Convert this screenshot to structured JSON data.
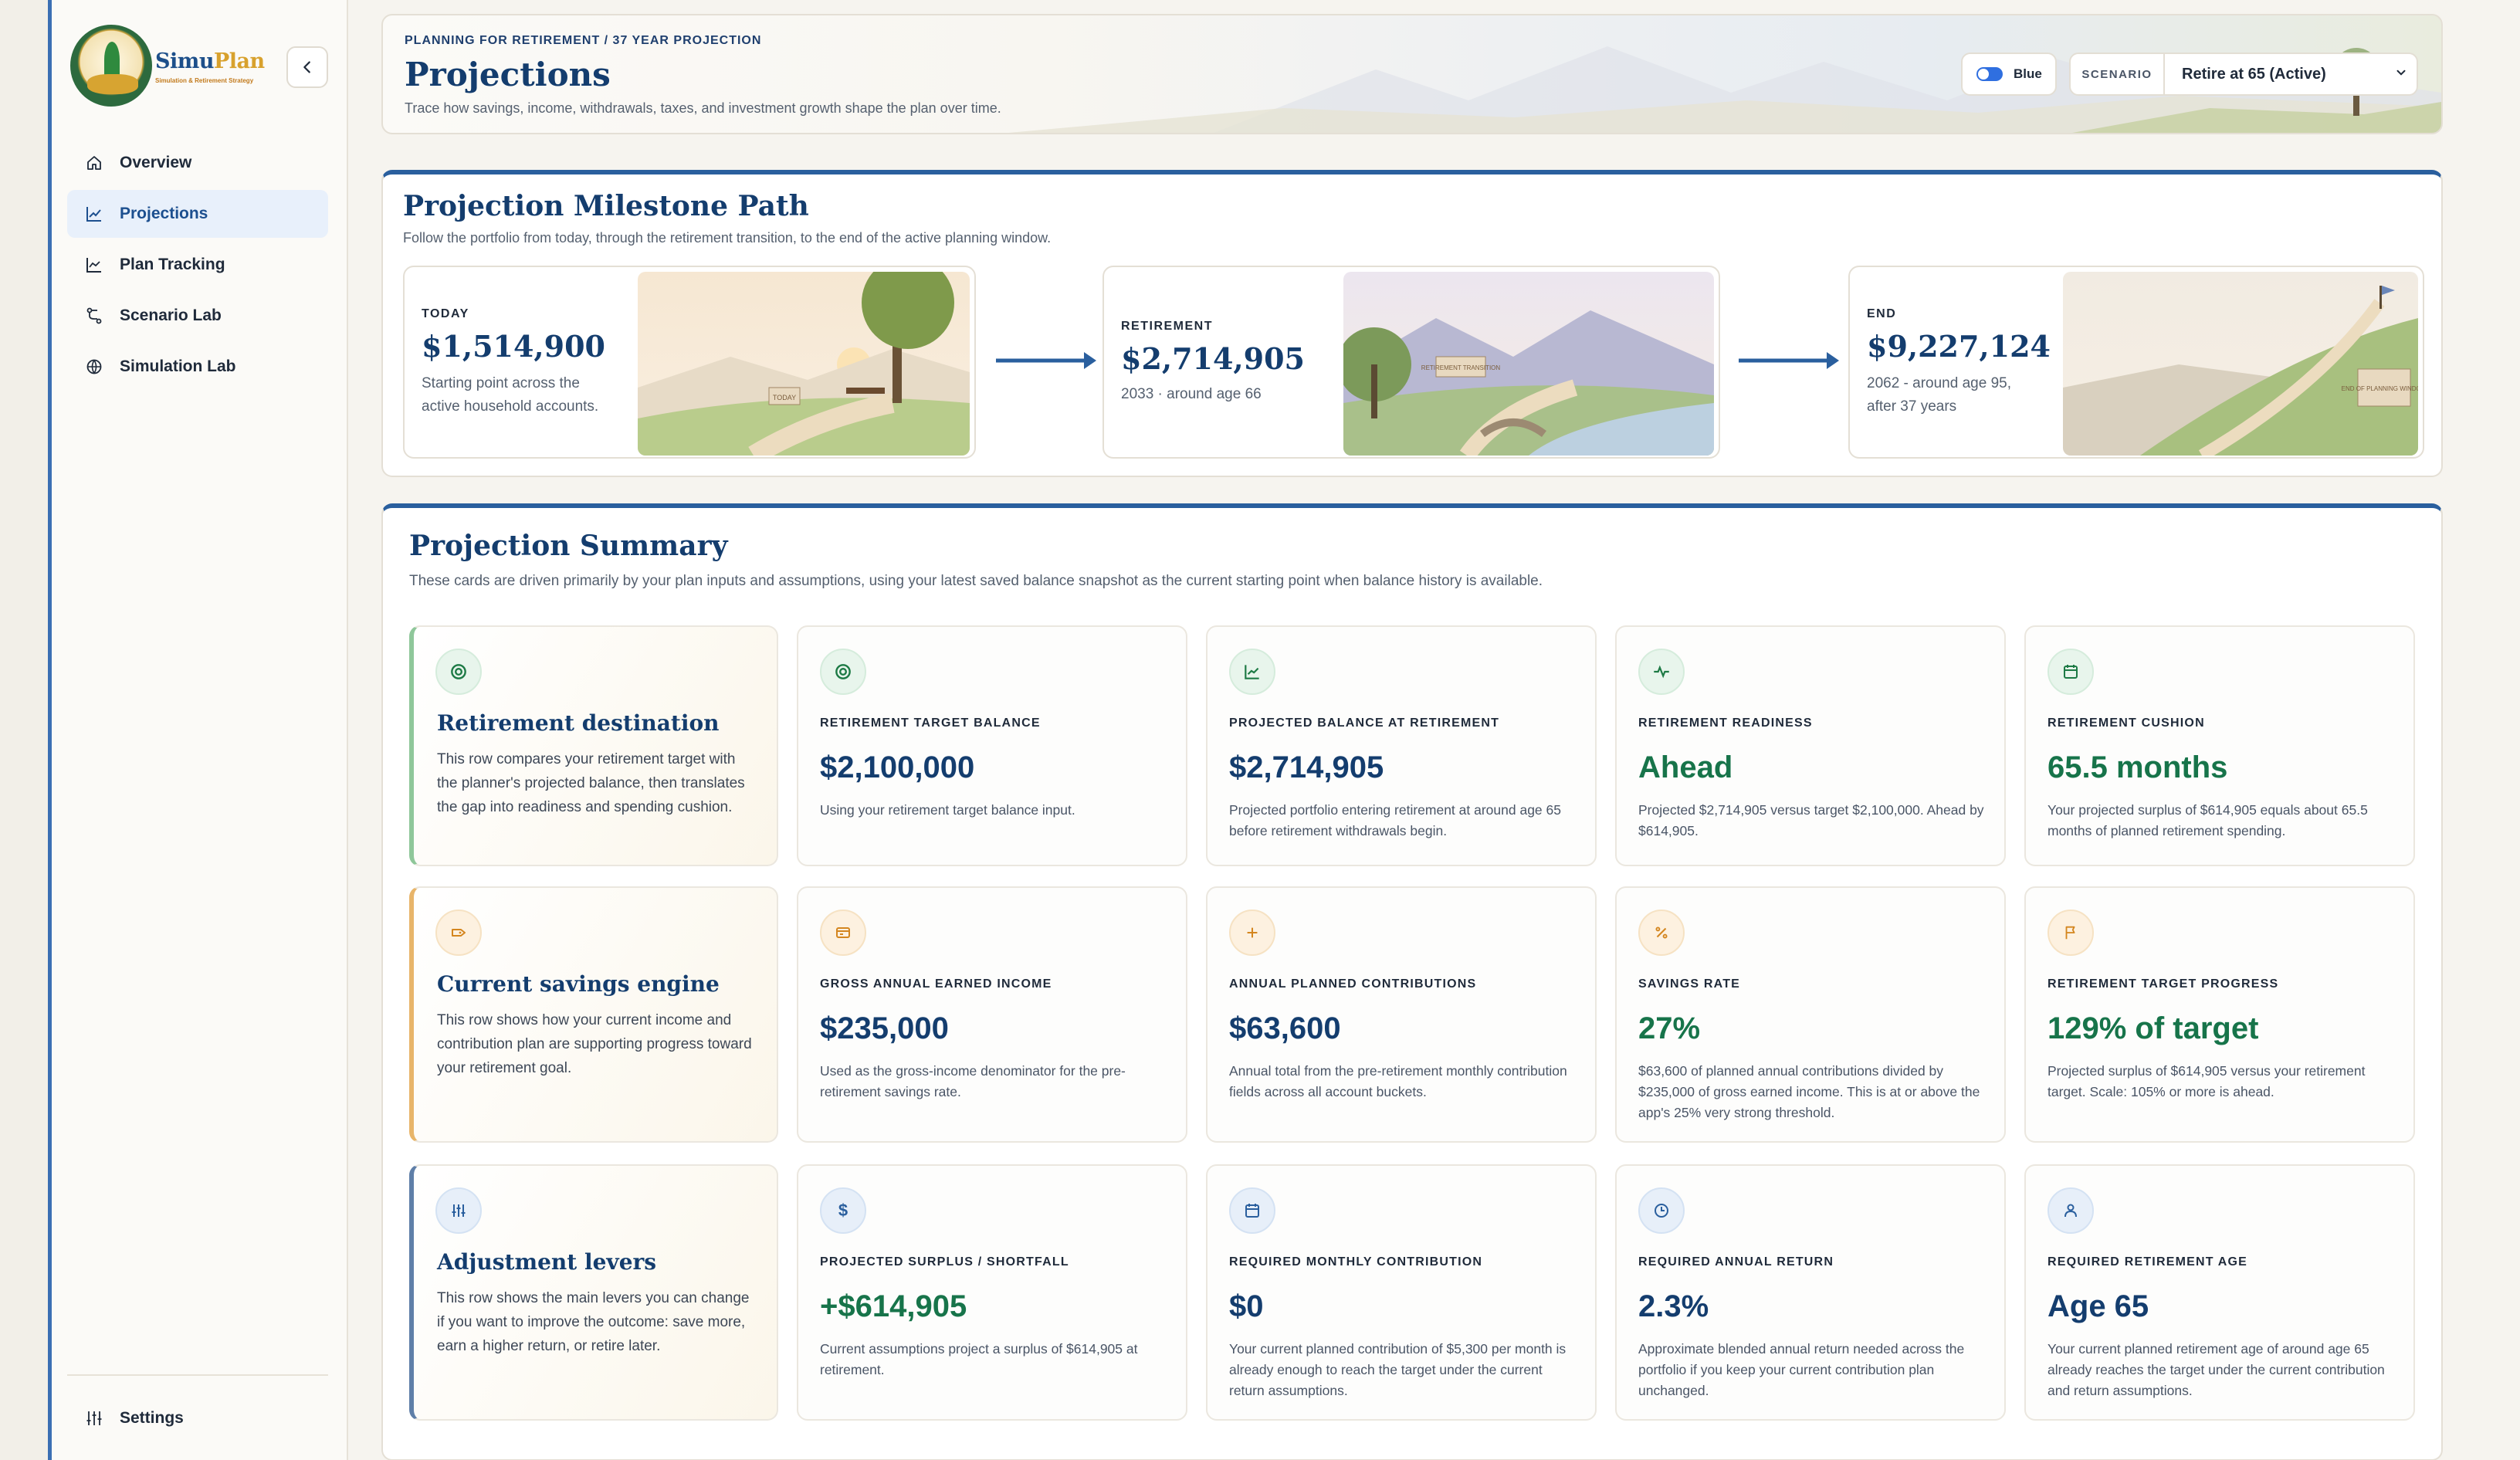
{
  "brand": {
    "name_a": "Simu",
    "name_b": "Plan",
    "tagline": "Simulation & Retirement Strategy"
  },
  "sidebar": {
    "items": [
      {
        "label": "Overview",
        "icon": "home-icon",
        "active": false
      },
      {
        "label": "Projections",
        "icon": "trend-chart-icon",
        "active": true
      },
      {
        "label": "Plan Tracking",
        "icon": "line-chart-icon",
        "active": false
      },
      {
        "label": "Scenario Lab",
        "icon": "branch-icon",
        "active": false
      },
      {
        "label": "Simulation Lab",
        "icon": "globe-icon",
        "active": false
      }
    ],
    "settings_label": "Settings"
  },
  "header": {
    "eyebrow": "PLANNING FOR RETIREMENT / 37 YEAR PROJECTION",
    "title": "Projections",
    "subtitle": "Trace how savings, income, withdrawals, taxes, and investment growth shape the plan over time.",
    "theme_label": "Blue",
    "scenario_label": "SCENARIO",
    "scenario_value": "Retire at 65 (Active)"
  },
  "milestones": {
    "title": "Projection Milestone Path",
    "subtitle": "Follow the portfolio from today, through the retirement transition, to the end of the active planning window.",
    "today": {
      "label": "TODAY",
      "value": "$1,514,900",
      "sub": "Starting point across the active household accounts.",
      "sign_text": "TODAY"
    },
    "retirement": {
      "label": "RETIREMENT",
      "value": "$2,714,905",
      "sub": "2033 · around age 66",
      "sign_text": "RETIREMENT TRANSITION"
    },
    "end": {
      "label": "END",
      "value": "$9,227,124",
      "sub": "2062 - around age 95, after 37 years",
      "sign_text": "END OF PLANNING WINDOW"
    }
  },
  "summary": {
    "title": "Projection Summary",
    "subtitle": "These cards are driven primarily by your plan inputs and assumptions, using your latest saved balance snapshot as the current starting point when balance history is available.",
    "rows": [
      {
        "intro": {
          "title": "Retirement destination",
          "body": "This row compares your retirement target with the planner's projected balance, then translates the gap into readiness and spending cushion."
        },
        "cards": [
          {
            "label": "RETIREMENT TARGET BALANCE",
            "value": "$2,100,000",
            "desc": "Using your retirement target balance input."
          },
          {
            "label": "PROJECTED BALANCE AT RETIREMENT",
            "value": "$2,714,905",
            "desc": "Projected portfolio entering retirement at around age 65 before retirement withdrawals begin."
          },
          {
            "label": "RETIREMENT READINESS",
            "value": "Ahead",
            "desc": "Projected $2,714,905 versus target $2,100,000. Ahead by $614,905."
          },
          {
            "label": "RETIREMENT CUSHION",
            "value": "65.5 months",
            "desc": "Your projected surplus of $614,905 equals about 65.5 months of planned retirement spending."
          }
        ]
      },
      {
        "intro": {
          "title": "Current savings engine",
          "body": "This row shows how your current income and contribution plan are supporting progress toward your retirement goal."
        },
        "cards": [
          {
            "label": "GROSS ANNUAL EARNED INCOME",
            "value": "$235,000",
            "desc": "Used as the gross-income denominator for the pre-retirement savings rate."
          },
          {
            "label": "ANNUAL PLANNED CONTRIBUTIONS",
            "value": "$63,600",
            "desc": "Annual total from the pre-retirement monthly contribution fields across all account buckets."
          },
          {
            "label": "SAVINGS RATE",
            "value": "27%",
            "desc": "$63,600 of planned annual contributions divided by $235,000 of gross earned income. This is at or above the app's 25% very strong threshold."
          },
          {
            "label": "RETIREMENT TARGET PROGRESS",
            "value": "129% of target",
            "desc": "Projected surplus of $614,905 versus your retirement target. Scale: 105% or more is ahead."
          }
        ]
      },
      {
        "intro": {
          "title": "Adjustment levers",
          "body": "This row shows the main levers you can change if you want to improve the outcome: save more, earn a higher return, or retire later."
        },
        "cards": [
          {
            "label": "PROJECTED SURPLUS / SHORTFALL",
            "value": "+$614,905",
            "desc": "Current assumptions project a surplus of $614,905 at retirement."
          },
          {
            "label": "REQUIRED MONTHLY CONTRIBUTION",
            "value": "$0",
            "desc": "Your current planned contribution of $5,300 per month is already enough to reach the target under the current return assumptions."
          },
          {
            "label": "REQUIRED ANNUAL RETURN",
            "value": "2.3%",
            "desc": "Approximate blended annual return needed across the portfolio if you keep your current contribution plan unchanged."
          },
          {
            "label": "REQUIRED RETIREMENT AGE",
            "value": "Age 65",
            "desc": "Your current planned retirement age of around age 65 already reaches the target under the current contribution and return assumptions."
          }
        ]
      }
    ]
  },
  "colors": {
    "primary": "#143d6e",
    "accent_blue": "#2a5f9e",
    "positive_green": "#17744a",
    "amber": "#d4861f"
  }
}
